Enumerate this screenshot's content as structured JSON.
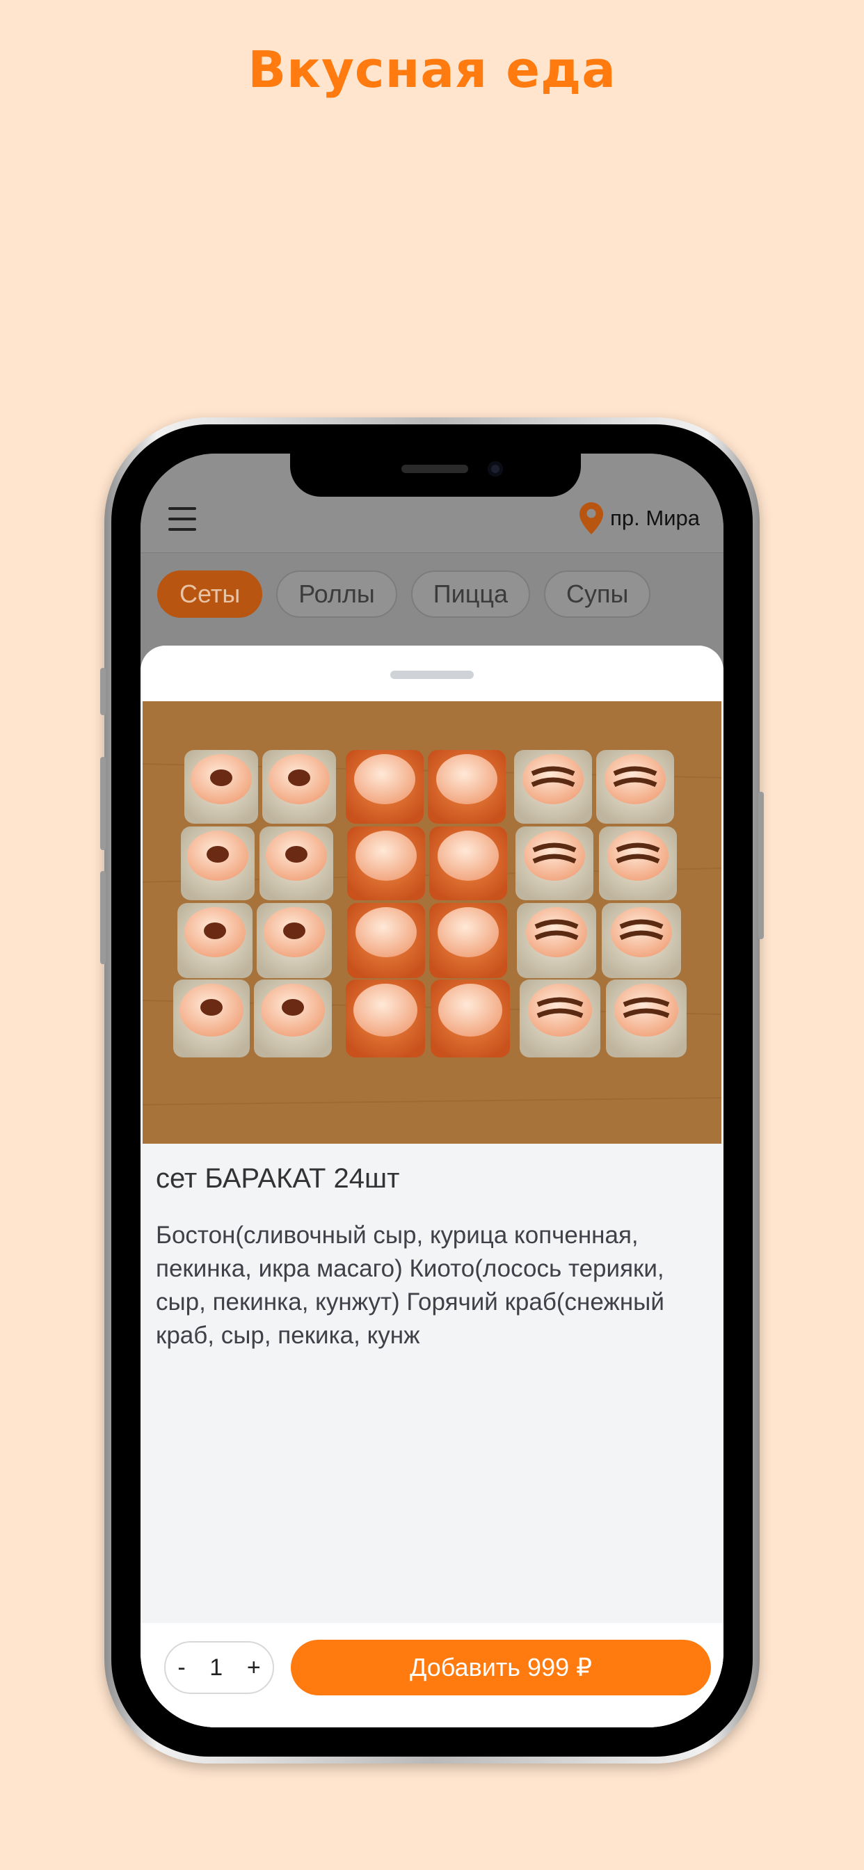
{
  "headline": "Вкусная еда",
  "header": {
    "location": "пр. Мира"
  },
  "categories": [
    {
      "label": "Сеты",
      "active": true
    },
    {
      "label": "Роллы",
      "active": false
    },
    {
      "label": "Пицца",
      "active": false
    },
    {
      "label": "Супы",
      "active": false
    }
  ],
  "product": {
    "title": "сет БАРАКАТ 24шт",
    "description": "Бостон(сливочный сыр, курица копченная, пекинка, икра масаго) Киото(лосось терияки, сыр, пекинка, кунжут) Горячий краб(снежный краб, сыр, пекика, кунж"
  },
  "cart": {
    "minus": "-",
    "quantity": "1",
    "plus": "+",
    "add_label": "Добавить 999 ₽"
  },
  "colors": {
    "accent": "#FF7A0F",
    "background": "#FFE5CE",
    "chip_active_dimmed": "#B85510"
  },
  "icons": {
    "menu": "hamburger-menu-icon",
    "location": "map-pin-icon"
  }
}
